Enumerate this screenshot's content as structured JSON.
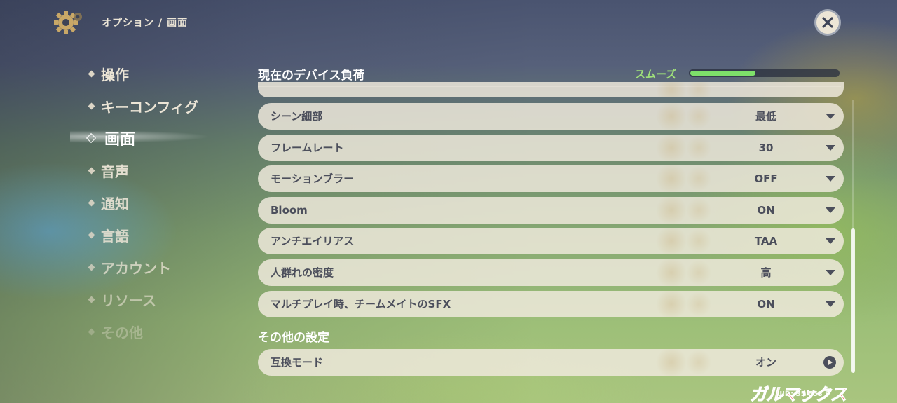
{
  "header": {
    "breadcrumb_section": "オプション",
    "breadcrumb_separator": "/",
    "breadcrumb_page": "画面",
    "settings_icon": "gear-icon",
    "close_icon": "close-icon"
  },
  "sidebar": {
    "items": [
      {
        "label": "操作",
        "active": false
      },
      {
        "label": "キーコンフィグ",
        "active": false
      },
      {
        "label": "画面",
        "active": true
      },
      {
        "label": "音声",
        "active": false
      },
      {
        "label": "通知",
        "active": false
      },
      {
        "label": "言語",
        "active": false
      },
      {
        "label": "アカウント",
        "active": false
      },
      {
        "label": "リソース",
        "active": false
      },
      {
        "label": "その他",
        "active": false
      }
    ]
  },
  "main": {
    "device_load": {
      "title": "現在のデバイス負荷",
      "status": "スムーズ",
      "level_fraction": 0.44,
      "color": "#7ee06a"
    },
    "settings": [
      {
        "label": "シーン細部",
        "value": "最低",
        "control": "dropdown"
      },
      {
        "label": "フレームレート",
        "value": "30",
        "control": "dropdown"
      },
      {
        "label": "モーションブラー",
        "value": "OFF",
        "control": "dropdown"
      },
      {
        "label": "Bloom",
        "value": "ON",
        "control": "dropdown"
      },
      {
        "label": "アンチエイリアス",
        "value": "TAA",
        "control": "dropdown"
      },
      {
        "label": "人群れの密度",
        "value": "高",
        "control": "dropdown"
      },
      {
        "label": "マルチプレイ時、チームメイトのSFX",
        "value": "ON",
        "control": "dropdown"
      }
    ],
    "other_settings": {
      "title": "その他の設定",
      "items": [
        {
          "label": "互換モード",
          "value": "オン",
          "control": "arrow"
        }
      ]
    }
  },
  "footer": {
    "uid": "UID: 35 553 9",
    "watermark": "ガルマックス"
  }
}
